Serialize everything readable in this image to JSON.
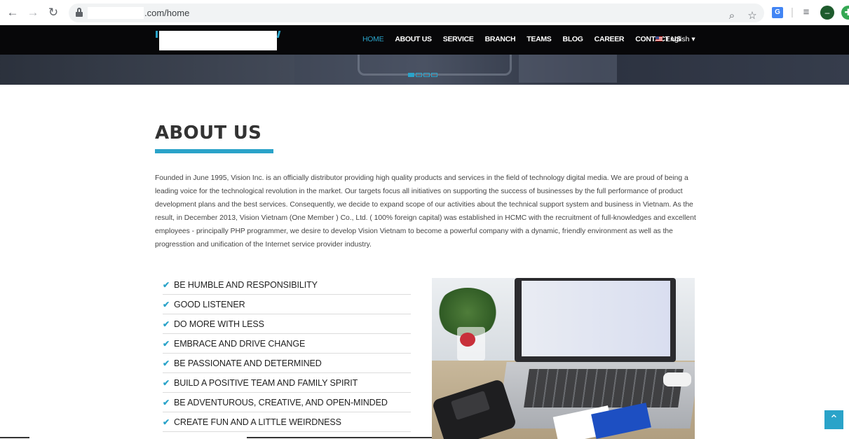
{
  "browser": {
    "url_suffix": ".com/home"
  },
  "header": {
    "nav": [
      {
        "label": "HOME",
        "active": true
      },
      {
        "label": "ABOUT US",
        "active": false
      },
      {
        "label": "SERVICE",
        "active": false
      },
      {
        "label": "BRANCH",
        "active": false
      },
      {
        "label": "TEAMS",
        "active": false
      },
      {
        "label": "BLOG",
        "active": false
      },
      {
        "label": "CAREER",
        "active": false
      },
      {
        "label": "CONTACT US",
        "active": false
      }
    ],
    "language": "English",
    "language_caret": "▾"
  },
  "slider": {
    "slide_count": 4,
    "active_index": 0
  },
  "about": {
    "title": "ABOUT US",
    "intro": "Founded in June 1995, Vision Inc. is an officially distributor providing high quality products and services in the field of technology digital media. We are proud of being a leading voice for the technological revolution in the market. Our targets focus all initiatives on supporting the success of businesses by the full performance of product development plans and the best services. Consequently, we decide to expand scope of our activities about the technical support system and business in Vietnam. As the result, in December 2013, Vision Vietnam (One Member ) Co., Ltd. ( 100% foreign capital) was established in HCMC with the recruitment of full-knowledges and excellent employees - principally PHP programmer, we desire to develop Vision Vietnam to become a powerful company with a dynamic, friendly environment as well as the progresstion and unification of the Internet service provider industry.",
    "values": [
      "BE HUMBLE AND RESPONSIBILITY",
      "GOOD LISTENER",
      "DO MORE WITH LESS",
      "EMBRACE AND DRIVE CHANGE",
      "BE PASSIONATE AND DETERMINED",
      "BUILD A POSITIVE TEAM AND FAMILY SPIRIT",
      "BE ADVENTUROUS, CREATIVE, AND OPEN-MINDED",
      "CREATE FUN AND A LITTLE WEIRDNESS"
    ]
  },
  "colors": {
    "accent": "#2aa3c9",
    "header_bg": "#070709"
  },
  "icons": {
    "back": "arrow-left-icon",
    "forward": "arrow-right-icon",
    "reload": "reload-icon",
    "lock": "lock-icon",
    "zoom": "zoom-icon",
    "star": "star-icon",
    "translate": "translate-icon",
    "media": "media-icon",
    "profile": "profile-icon",
    "check": "check-icon",
    "scroll_top": "chevron-up-icon"
  }
}
